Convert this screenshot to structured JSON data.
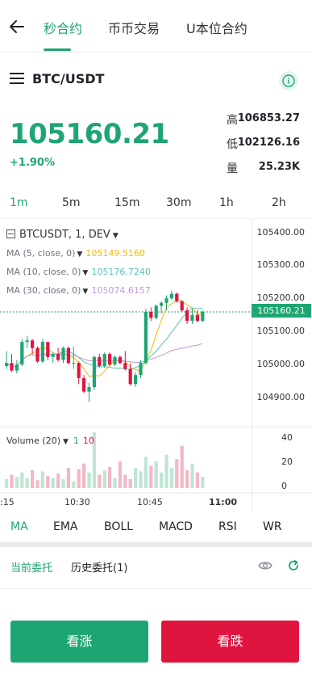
{
  "nav": {
    "tabs": [
      {
        "label": "秒合约",
        "active": true
      },
      {
        "label": "币币交易",
        "active": false
      },
      {
        "label": "U本位合约",
        "active": false
      }
    ]
  },
  "ticker": {
    "pair": "BTC/USDT",
    "price": "105160.21",
    "change": "+1.90%",
    "stats": [
      {
        "label": "高",
        "value": "106853.27"
      },
      {
        "label": "低",
        "value": "102126.16"
      },
      {
        "label": "量",
        "value": "25.23K"
      }
    ]
  },
  "intervals": [
    "1m",
    "5m",
    "15m",
    "30m",
    "1h",
    "2h"
  ],
  "active_interval": "1m",
  "chart": {
    "symbol_line": "BTCUSDT, 1, DEV",
    "ma_legends": [
      {
        "label": "MA (5, close, 0)",
        "value": "105149.5160",
        "color": "#f0b90b"
      },
      {
        "label": "MA (10, close, 0)",
        "value": "105176.7240",
        "color": "#59c3b8"
      },
      {
        "label": "MA (30, close, 0)",
        "value": "105074.6157",
        "color": "#c39ad9"
      }
    ],
    "price_ticks": [
      "105400.00",
      "105300.00",
      "105200.00",
      "105100.00",
      "105000.00",
      "104900.00"
    ],
    "current_price_tag": "105160.21",
    "volume_legend": {
      "label": "Volume (20)",
      "up": "1",
      "down": "10"
    },
    "volume_ticks": [
      "40",
      "20",
      "0"
    ],
    "time_ticks": [
      ":15",
      "10:30",
      "10:45",
      "11:00"
    ],
    "colors": {
      "up": "#1ea672",
      "down": "#e0153f",
      "up_vol": "#bfe5d4",
      "down_vol": "#f2b8c6"
    }
  },
  "chart_data": {
    "type": "candlestick",
    "ylim": [
      104800,
      105450
    ],
    "x_labels": [
      ":15",
      "10:30",
      "10:45",
      "11:00"
    ],
    "candles": [
      {
        "o": 104980,
        "h": 105030,
        "l": 104970,
        "c": 104990
      },
      {
        "o": 104990,
        "h": 105020,
        "l": 104960,
        "c": 104965
      },
      {
        "o": 104965,
        "h": 105000,
        "l": 104955,
        "c": 104985
      },
      {
        "o": 104985,
        "h": 105070,
        "l": 104980,
        "c": 105060
      },
      {
        "o": 105060,
        "h": 105080,
        "l": 105040,
        "c": 105065
      },
      {
        "o": 105065,
        "h": 105070,
        "l": 105020,
        "c": 105040
      },
      {
        "o": 105040,
        "h": 105045,
        "l": 104990,
        "c": 104995
      },
      {
        "o": 104995,
        "h": 105070,
        "l": 104990,
        "c": 105060
      },
      {
        "o": 105060,
        "h": 105060,
        "l": 105000,
        "c": 105010
      },
      {
        "o": 105010,
        "h": 105025,
        "l": 104990,
        "c": 105020
      },
      {
        "o": 105020,
        "h": 105040,
        "l": 104995,
        "c": 105000
      },
      {
        "o": 105000,
        "h": 105045,
        "l": 104990,
        "c": 105040
      },
      {
        "o": 105040,
        "h": 105045,
        "l": 104985,
        "c": 104990
      },
      {
        "o": 104990,
        "h": 105045,
        "l": 104970,
        "c": 104990
      },
      {
        "o": 104990,
        "h": 104995,
        "l": 104920,
        "c": 104940
      },
      {
        "o": 104940,
        "h": 104950,
        "l": 104890,
        "c": 104895
      },
      {
        "o": 104895,
        "h": 104925,
        "l": 104860,
        "c": 104910
      },
      {
        "o": 104910,
        "h": 105015,
        "l": 104900,
        "c": 105010
      },
      {
        "o": 105010,
        "h": 105020,
        "l": 104975,
        "c": 104980
      },
      {
        "o": 104980,
        "h": 105025,
        "l": 104975,
        "c": 105020
      },
      {
        "o": 105020,
        "h": 105025,
        "l": 104980,
        "c": 104985
      },
      {
        "o": 104985,
        "h": 105015,
        "l": 104980,
        "c": 105010
      },
      {
        "o": 105010,
        "h": 105015,
        "l": 104985,
        "c": 104990
      },
      {
        "o": 104990,
        "h": 105030,
        "l": 104965,
        "c": 104970
      },
      {
        "o": 104970,
        "h": 104990,
        "l": 104915,
        "c": 104920
      },
      {
        "o": 104920,
        "h": 104960,
        "l": 104910,
        "c": 104950
      },
      {
        "o": 104950,
        "h": 105000,
        "l": 104940,
        "c": 104990
      },
      {
        "o": 104990,
        "h": 105170,
        "l": 104985,
        "c": 105160
      },
      {
        "o": 105160,
        "h": 105175,
        "l": 105130,
        "c": 105140
      },
      {
        "o": 105140,
        "h": 105185,
        "l": 105135,
        "c": 105180
      },
      {
        "o": 105180,
        "h": 105195,
        "l": 105155,
        "c": 105190
      },
      {
        "o": 105190,
        "h": 105215,
        "l": 105165,
        "c": 105205
      },
      {
        "o": 105205,
        "h": 105230,
        "l": 105200,
        "c": 105220
      },
      {
        "o": 105220,
        "h": 105225,
        "l": 105190,
        "c": 105195
      },
      {
        "o": 105195,
        "h": 105200,
        "l": 105160,
        "c": 105165
      },
      {
        "o": 105165,
        "h": 105175,
        "l": 105120,
        "c": 105130
      },
      {
        "o": 105130,
        "h": 105170,
        "l": 105120,
        "c": 105150
      },
      {
        "o": 105150,
        "h": 105165,
        "l": 105125,
        "c": 105130
      },
      {
        "o": 105130,
        "h": 105165,
        "l": 105125,
        "c": 105160
      }
    ],
    "volumes": [
      8,
      12,
      10,
      14,
      9,
      16,
      7,
      15,
      11,
      9,
      13,
      8,
      18,
      6,
      17,
      22,
      14,
      50,
      12,
      16,
      19,
      9,
      24,
      12,
      8,
      18,
      15,
      28,
      20,
      24,
      14,
      30,
      18,
      26,
      38,
      16,
      22,
      14,
      10
    ],
    "volume_ylim": [
      0,
      45
    ]
  },
  "indicators": [
    "MA",
    "EMA",
    "BOLL",
    "MACD",
    "RSI",
    "WR"
  ],
  "active_indicator": "MA",
  "orders": {
    "tabs": [
      {
        "label": "当前委托",
        "active": true
      },
      {
        "label": "历史委托(1)",
        "active": false
      }
    ]
  },
  "actions": {
    "buy_label": "看涨",
    "sell_label": "看跌"
  }
}
